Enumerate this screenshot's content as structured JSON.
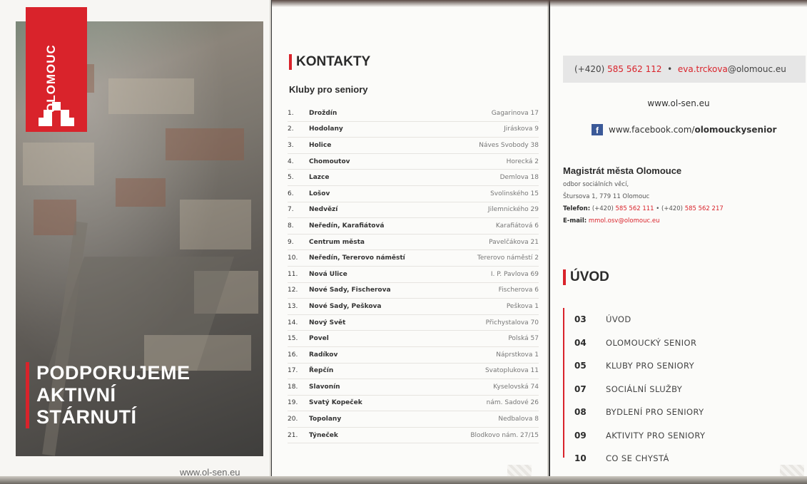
{
  "cover": {
    "city": "OLOMOUC",
    "headline": [
      "PODPORUJEME",
      "AKTIVNÍ",
      "STÁRNUTÍ"
    ],
    "url": "www.ol-sen.eu"
  },
  "contacts": {
    "title": "KONTAKTY",
    "subtitle": "Kluby pro seniory",
    "clubs": [
      {
        "num": "1.",
        "name": "Droždín",
        "address": "Gagarinova 17"
      },
      {
        "num": "2.",
        "name": "Hodolany",
        "address": "Jiráskova 9"
      },
      {
        "num": "3.",
        "name": "Holice",
        "address": "Náves Svobody 38"
      },
      {
        "num": "4.",
        "name": "Chomoutov",
        "address": "Horecká 2"
      },
      {
        "num": "5.",
        "name": "Lazce",
        "address": "Demlova 18"
      },
      {
        "num": "6.",
        "name": "Lošov",
        "address": "Svolinského 15"
      },
      {
        "num": "7.",
        "name": "Nedvězí",
        "address": "Jilemnického 29"
      },
      {
        "num": "8.",
        "name": "Neředín, Karafiátová",
        "address": "Karafiátová 6"
      },
      {
        "num": "9.",
        "name": "Centrum města",
        "address": "Pavelčákova 21"
      },
      {
        "num": "10.",
        "name": "Neředín, Tererovo náměstí",
        "address": "Tererovo náměstí 2"
      },
      {
        "num": "11.",
        "name": "Nová Ulice",
        "address": "I. P. Pavlova 69"
      },
      {
        "num": "12.",
        "name": "Nové Sady, Fischerova",
        "address": "Fischerova 6"
      },
      {
        "num": "13.",
        "name": "Nové Sady, Peškova",
        "address": "Peškova 1"
      },
      {
        "num": "14.",
        "name": "Nový Svět",
        "address": "Přichystalova 70"
      },
      {
        "num": "15.",
        "name": "Povel",
        "address": "Polská 57"
      },
      {
        "num": "16.",
        "name": "Radíkov",
        "address": "Náprstkova 1"
      },
      {
        "num": "17.",
        "name": "Řepčín",
        "address": "Svatoplukova 11"
      },
      {
        "num": "18.",
        "name": "Slavonín",
        "address": "Kyselovská 74"
      },
      {
        "num": "19.",
        "name": "Svatý Kopeček",
        "address": "nám. Sadové 26"
      },
      {
        "num": "20.",
        "name": "Topolany",
        "address": "Nedbalova 8"
      },
      {
        "num": "21.",
        "name": "Týneček",
        "address": "Blodkovo nám. 27/15"
      }
    ]
  },
  "info": {
    "phone_prefix": "(+420)",
    "phone_number": "585 562 112",
    "bullet": "•",
    "email_user": "eva.trckova",
    "email_domain": "@olomouc.eu",
    "web": "www.ol-sen.eu",
    "facebook_base": "www.facebook.com/",
    "facebook_page": "olomouckysenior",
    "office": {
      "name": "Magistrát města Olomouce",
      "department": "odbor sociálních věcí,",
      "address": "Štursova 1, 779 11 Olomouc",
      "phone_label": "Telefon:",
      "phone_prefix_1": "(+420)",
      "phone_1": "585 562 111",
      "phone_sep": "•",
      "phone_prefix_2": "(+420)",
      "phone_2": "585 562 217",
      "email_label": "E-mail:",
      "email": "mmol.osv@olomouc.eu"
    }
  },
  "toc": {
    "title": "ÚVOD",
    "items": [
      {
        "page": "03",
        "label": "ÚVOD"
      },
      {
        "page": "04",
        "label": "OLOMOUCKÝ SENIOR"
      },
      {
        "page": "05",
        "label": "KLUBY PRO SENIORY"
      },
      {
        "page": "07",
        "label": "SOCIÁLNÍ SLUŽBY"
      },
      {
        "page": "08",
        "label": "BYDLENÍ PRO SENIORY"
      },
      {
        "page": "09",
        "label": "AKTIVITY PRO SENIORY"
      },
      {
        "page": "10",
        "label": "CO SE CHYSTÁ"
      }
    ]
  },
  "colors": {
    "accent": "#d9232b",
    "facebook": "#3b5998"
  }
}
